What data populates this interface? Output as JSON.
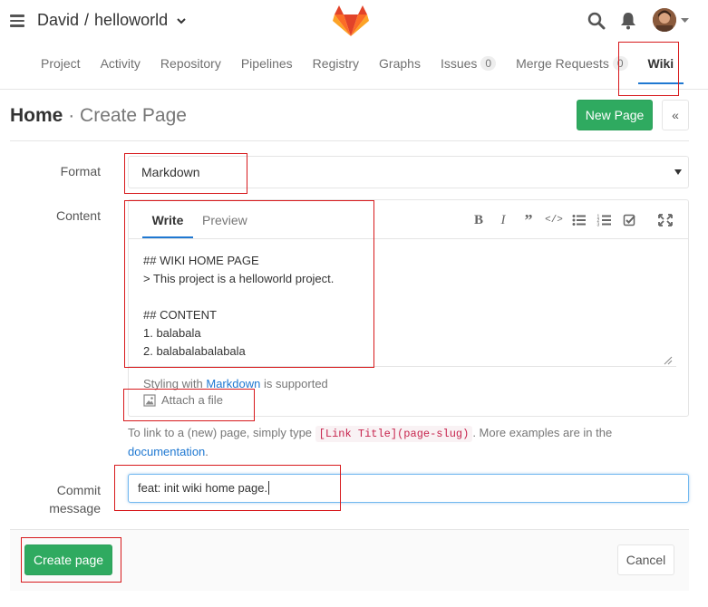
{
  "header": {
    "owner": "David",
    "separator": "/",
    "project": "helloworld"
  },
  "nav": {
    "items": [
      {
        "label": "Project"
      },
      {
        "label": "Activity"
      },
      {
        "label": "Repository"
      },
      {
        "label": "Pipelines"
      },
      {
        "label": "Registry"
      },
      {
        "label": "Graphs"
      },
      {
        "label": "Issues",
        "count": "0"
      },
      {
        "label": "Merge Requests",
        "count": "0"
      },
      {
        "label": "Wiki",
        "active": true
      }
    ]
  },
  "page": {
    "title": "Home",
    "subtitle": "· Create Page",
    "new_page_label": "New Page",
    "collapse_label": "«"
  },
  "form": {
    "format_label": "Format",
    "format_value": "Markdown",
    "content_label": "Content",
    "tabs": {
      "write": "Write",
      "preview": "Preview"
    },
    "toolbar_icons": [
      "bold-icon",
      "italic-icon",
      "quote-icon",
      "code-icon",
      "bullet-list-icon",
      "numbered-list-icon",
      "checklist-icon",
      "fullscreen-icon"
    ],
    "content_lines": [
      "## WIKI HOME PAGE",
      "> This project is a helloworld project.",
      "",
      "## CONTENT",
      "1. balabala",
      "2. balabalabalabala"
    ],
    "styling_prefix": "Styling with",
    "styling_link": "Markdown",
    "styling_suffix": "is supported",
    "attach_label": "Attach a file",
    "help_prefix": "To link to a (new) page, simply type",
    "help_code": "[Link Title](page-slug)",
    "help_suffix": ". More examples are in the",
    "help_link": "documentation",
    "help_end": ".",
    "commit_label_1": "Commit",
    "commit_label_2": "message",
    "commit_value": "feat: init wiki home page.",
    "create_label": "Create page",
    "cancel_label": "Cancel"
  },
  "colors": {
    "accent": "#1f78d1",
    "success": "#2faa60",
    "annotation": "#d7191c"
  }
}
